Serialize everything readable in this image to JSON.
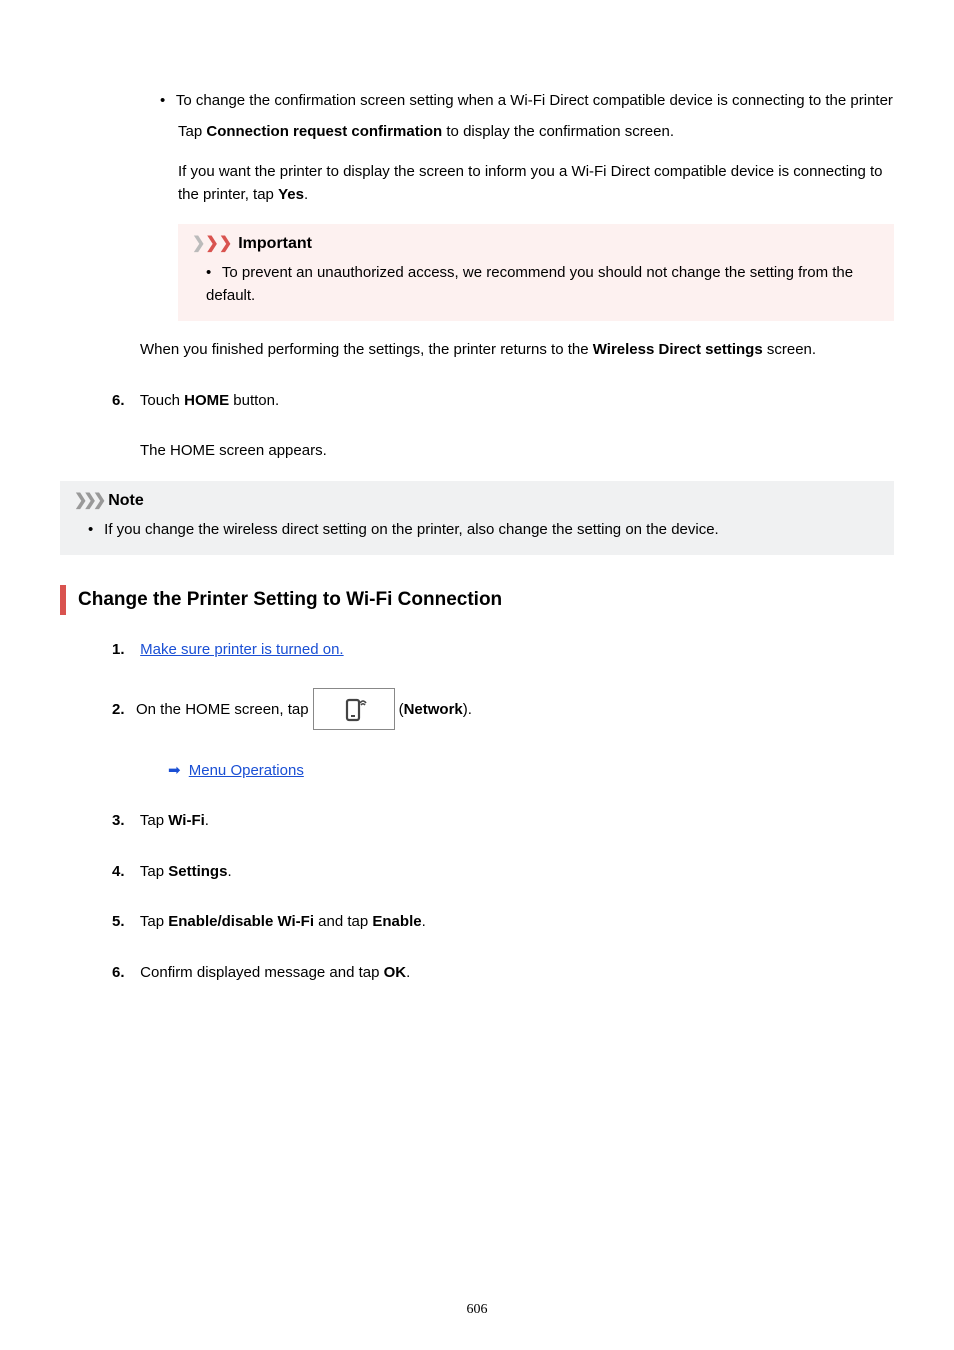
{
  "intro_bullet": "To change the confirmation screen setting when a Wi-Fi Direct compatible device is connecting to the printer",
  "intro_line1_a": "Tap ",
  "intro_line1_b": "Connection request confirmation",
  "intro_line1_c": " to display the confirmation screen.",
  "intro_line2_a": "If you want the printer to display the screen to inform you a Wi-Fi Direct compatible device is connecting to the printer, tap ",
  "intro_line2_b": "Yes",
  "intro_line2_c": ".",
  "important_label": "Important",
  "important_bullet": "To prevent an unauthorized access, we recommend you should not change the setting from the default.",
  "after_important_a": "When you finished performing the settings, the printer returns to the ",
  "after_important_b": "Wireless Direct settings",
  "after_important_c": " screen.",
  "step6": {
    "num": "6.",
    "line_a": "Touch ",
    "line_b": "HOME",
    "line_c": " button.",
    "body": "The HOME screen appears."
  },
  "note_label": "Note",
  "note_bullet": "If you change the wireless direct setting on the printer, also change the setting on the device.",
  "section_title": "Change the Printer Setting to Wi-Fi Connection",
  "steps": {
    "s1": {
      "num": "1.",
      "link": "Make sure printer is turned on."
    },
    "s2": {
      "num": "2.",
      "pre": "On the HOME screen, tap",
      "post_a": " (",
      "post_b": "Network",
      "post_c": ").",
      "sub_link": "Menu Operations"
    },
    "s3": {
      "num": "3.",
      "pre": "Tap ",
      "bold": "Wi-Fi",
      "post": "."
    },
    "s4": {
      "num": "4.",
      "pre": "Tap ",
      "bold": "Settings",
      "post": "."
    },
    "s5": {
      "num": "5.",
      "pre": "Tap ",
      "bold1": "Enable/disable Wi-Fi",
      "mid": " and tap ",
      "bold2": "Enable",
      "post": "."
    },
    "s6": {
      "num": "6.",
      "pre": "Confirm displayed message and tap ",
      "bold": "OK",
      "post": "."
    }
  },
  "page_number": "606"
}
